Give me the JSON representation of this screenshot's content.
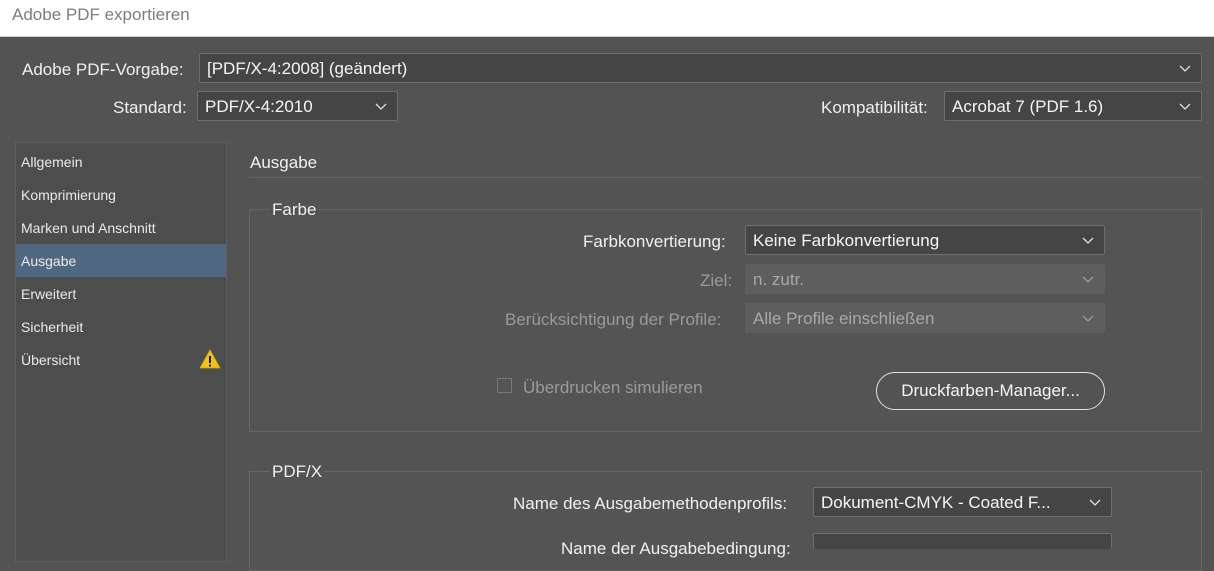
{
  "window": {
    "title": "Adobe PDF exportieren"
  },
  "header": {
    "preset_label": "Adobe PDF-Vorgabe:",
    "preset_value": "[PDF/X-4:2008] (geändert)",
    "standard_label": "Standard:",
    "standard_value": "PDF/X-4:2010",
    "compat_label": "Kompatibilität:",
    "compat_value": "Acrobat 7 (PDF 1.6)"
  },
  "sidebar": {
    "items": [
      {
        "label": "Allgemein"
      },
      {
        "label": "Komprimierung"
      },
      {
        "label": "Marken und Anschnitt"
      },
      {
        "label": "Ausgabe",
        "active": true
      },
      {
        "label": "Erweitert"
      },
      {
        "label": "Sicherheit"
      },
      {
        "label": "Übersicht",
        "icon": "warning-icon"
      }
    ]
  },
  "main": {
    "section_title": "Ausgabe",
    "color_group": {
      "title": "Farbe",
      "conversion_label": "Farbkonvertierung:",
      "conversion_value": "Keine Farbkonvertierung",
      "target_label": "Ziel:",
      "target_value": "n. zutr.",
      "profile_label": "Berücksichtigung der Profile:",
      "profile_value": "Alle Profile einschließen",
      "overprint_label": "Überdrucken simulieren",
      "overprint_checked": false,
      "ink_manager_label": "Druckfarben-Manager..."
    },
    "pdfx_group": {
      "title": "PDF/X",
      "profile_name_label": "Name des Ausgabemethodenprofils:",
      "profile_name_value": "Dokument-CMYK - Coated F...",
      "condition_label": "Name der Ausgabebedingung:",
      "condition_value": ""
    }
  },
  "colors": {
    "background": "#535353",
    "sidebar_active": "#4f6780",
    "warning": "#f2c21b"
  }
}
